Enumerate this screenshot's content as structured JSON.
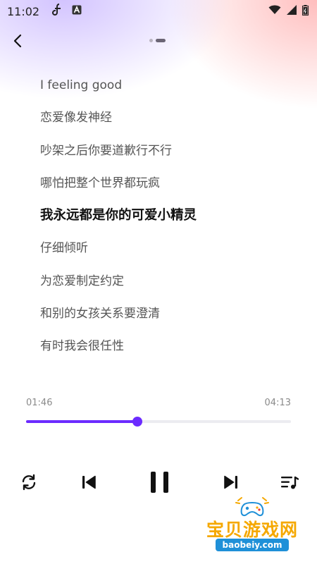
{
  "status_bar": {
    "time": "11:02",
    "icons": [
      "music-app-icon",
      "font-app-icon",
      "wifi-icon",
      "signal-icon",
      "battery-icon"
    ]
  },
  "header": {
    "back_icon": "chevron-left-icon",
    "page_indicator": {
      "count": 2,
      "active": 2
    }
  },
  "lyrics": {
    "lines": [
      "I feeling good",
      "恋爱像发神经",
      "吵架之后你要道歉行不行",
      "哪怕把整个世界都玩疯",
      "我永远都是你的可爱小精灵",
      "仔细倾听",
      "为恋爱制定约定",
      "和别的女孩关系要澄清",
      "有时我会很任性"
    ],
    "current_index": 4
  },
  "player": {
    "elapsed": "01:46",
    "duration": "04:13",
    "progress_fraction": 0.419,
    "accent_color": "#6c2bff",
    "controls": [
      "repeat-icon",
      "previous-icon",
      "pause-icon",
      "next-icon",
      "playlist-icon"
    ]
  },
  "watermark": {
    "title": "宝贝游戏网",
    "domain": "baobeiy.com"
  }
}
